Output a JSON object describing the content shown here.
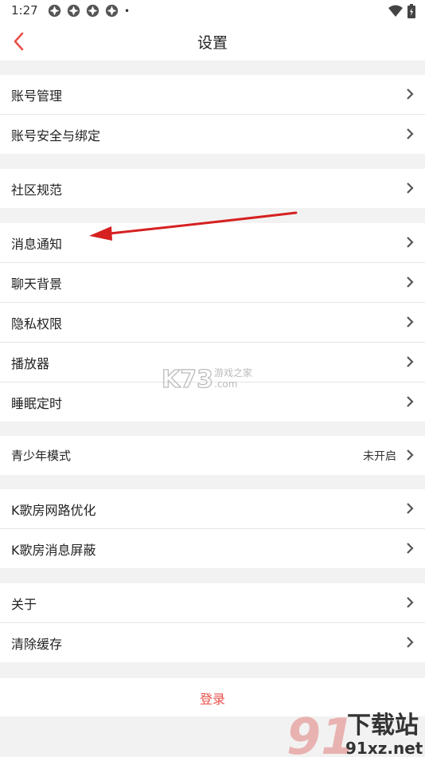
{
  "status_bar": {
    "time": "1:27",
    "notification_icons": [
      "app-notification-icon",
      "app-notification-icon",
      "app-notification-icon",
      "app-notification-icon"
    ],
    "dot": "•",
    "icons": [
      "wifi-icon",
      "battery-icon"
    ]
  },
  "header": {
    "title": "设置",
    "back_icon": "chevron-left-icon",
    "accent": "#e8504a"
  },
  "groups": [
    {
      "items": [
        {
          "label": "账号管理"
        },
        {
          "label": "账号安全与绑定"
        }
      ]
    },
    {
      "items": [
        {
          "label": "社区规范"
        }
      ]
    },
    {
      "items": [
        {
          "label": "消息通知"
        },
        {
          "label": "聊天背景"
        },
        {
          "label": "隐私权限"
        },
        {
          "label": "播放器"
        },
        {
          "label": "睡眠定时"
        }
      ]
    },
    {
      "items": [
        {
          "label": "青少年模式",
          "value": "未开启"
        }
      ]
    },
    {
      "items": [
        {
          "label": "K歌房网路优化"
        },
        {
          "label": "K歌房消息屏蔽"
        }
      ]
    },
    {
      "items": [
        {
          "label": "关于"
        },
        {
          "label": "清除缓存"
        }
      ]
    }
  ],
  "login": {
    "label": "登录",
    "color": "#e8504a"
  },
  "watermarks": {
    "k73": {
      "brand": "K73",
      "text_cn": "游戏之家",
      "text_en": ".com"
    },
    "site": {
      "text_cn": "下载站",
      "domain": "91xz.net"
    }
  },
  "annotation": {
    "arrow_color": "#d62020",
    "points_to": "消息通知"
  }
}
